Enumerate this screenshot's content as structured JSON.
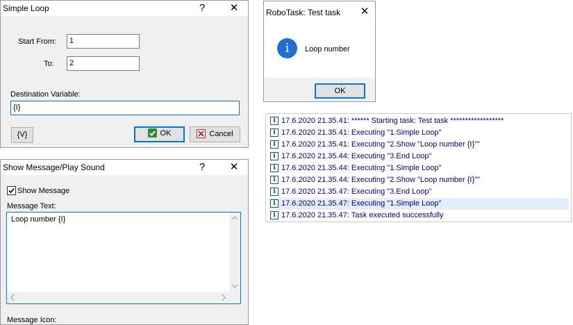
{
  "simple_loop": {
    "title": "Simple Loop",
    "help": "?",
    "close": "✕",
    "start_label": "Start From:",
    "start_value": "1",
    "to_label": "To:",
    "to_value": "2",
    "dest_label": "Destination Variable:",
    "dest_value": "{I}",
    "var_button": "{V}",
    "ok_label": "OK",
    "cancel_label": "Cancel"
  },
  "message_dialog": {
    "title": "RoboTask: Test task",
    "close": "✕",
    "message": "Loop number",
    "ok_label": "OK"
  },
  "show_message": {
    "title": "Show Message/Play Sound",
    "help": "?",
    "close": "✕",
    "checkbox_label": "Show Message",
    "checkbox_checked": true,
    "text_label": "Message Text:",
    "text_value": "Loop number {I}",
    "icon_label": "Message Icon:"
  },
  "log": {
    "rows": [
      {
        "text": "17.6.2020 21.35.41: ****** Starting task: Test task ******************",
        "selected": false
      },
      {
        "text": "17.6.2020 21.35.41: Executing \"1.Simple Loop\"",
        "selected": false
      },
      {
        "text": "17.6.2020 21.35.41: Executing \"2.Show \"Loop number {I}\"\"",
        "selected": false
      },
      {
        "text": "17.6.2020 21.35.44: Executing \"3.End Loop\"",
        "selected": false
      },
      {
        "text": "17.6.2020 21.35.44: Executing \"1.Simple Loop\"",
        "selected": false
      },
      {
        "text": "17.6.2020 21.35.44: Executing \"2.Show \"Loop number {I}\"\"",
        "selected": false
      },
      {
        "text": "17.6.2020 21.35.47: Executing \"3.End Loop\"",
        "selected": false
      },
      {
        "text": "17.6.2020 21.35.47: Executing \"1.Simple Loop\"",
        "selected": true
      },
      {
        "text": "17.6.2020 21.35.47: Task executed successfully",
        "selected": false
      }
    ]
  },
  "colors": {
    "accent": "#0078d7",
    "log_text": "#00008b",
    "log_selected": "#e3eef9",
    "ok_check": "#2e8b2e",
    "cancel_x": "#c0282c"
  }
}
